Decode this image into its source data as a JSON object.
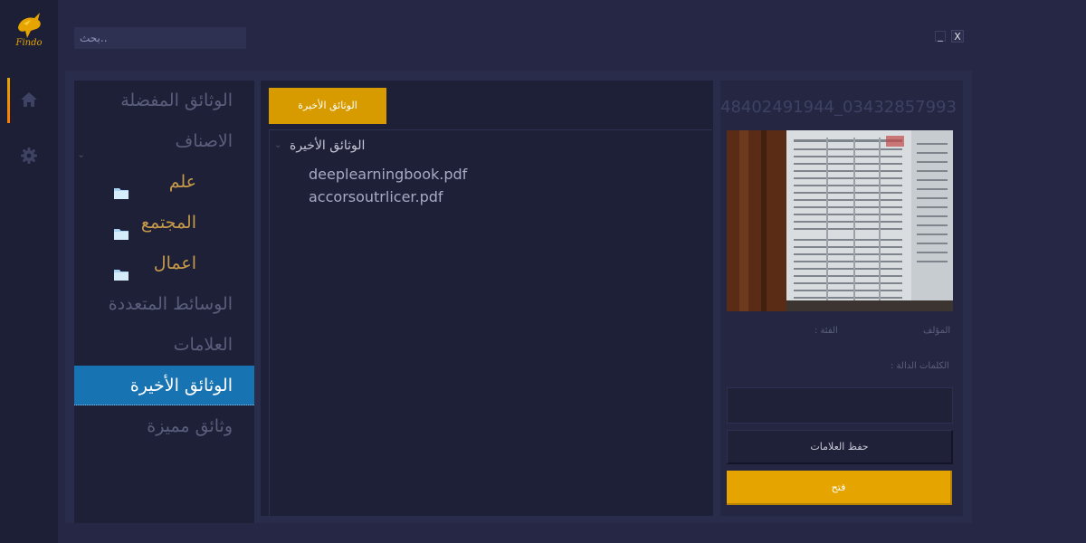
{
  "app": {
    "logo_text": "Findo"
  },
  "search": {
    "placeholder": "بحث.."
  },
  "window": {
    "minimize_label": "_",
    "close_label": "X"
  },
  "colors": {
    "accent": "#e6a400",
    "selection": "#1873b3",
    "background": "#252744",
    "panel": "#1e2037"
  },
  "rail": {
    "items": [
      {
        "icon": "home-icon",
        "active": true
      },
      {
        "icon": "gear-icon",
        "active": false
      }
    ]
  },
  "nav": {
    "items": [
      {
        "label": "الوثائق المفضلة"
      },
      {
        "label": "الاصناف"
      },
      {
        "label": "علم",
        "icon": "folder-icon"
      },
      {
        "label": "المجتمع",
        "icon": "folder-icon"
      },
      {
        "label": "اعمال",
        "icon": "folder-icon"
      },
      {
        "label": "الوسائط المتعددة"
      },
      {
        "label": "العلامات"
      },
      {
        "label": "الوثائق الأخيرة",
        "selected": true
      },
      {
        "label": "وثائق مميزة"
      }
    ]
  },
  "center": {
    "tab_label": "الوثائق الأخيرة",
    "tree": {
      "root_label": "الوثائق الأخيرة",
      "files": [
        "deeplearningbook.pdf",
        "accorsoutrlicer.pdf"
      ]
    }
  },
  "details": {
    "filename": "03432857993_48402491944",
    "author_label": "المؤلف",
    "category_label": "الفئة :",
    "keywords_label": "الكلمات الدالة :",
    "keywords_value": "",
    "save_tags_label": "حفظ العلامات",
    "open_label": "فتح"
  }
}
